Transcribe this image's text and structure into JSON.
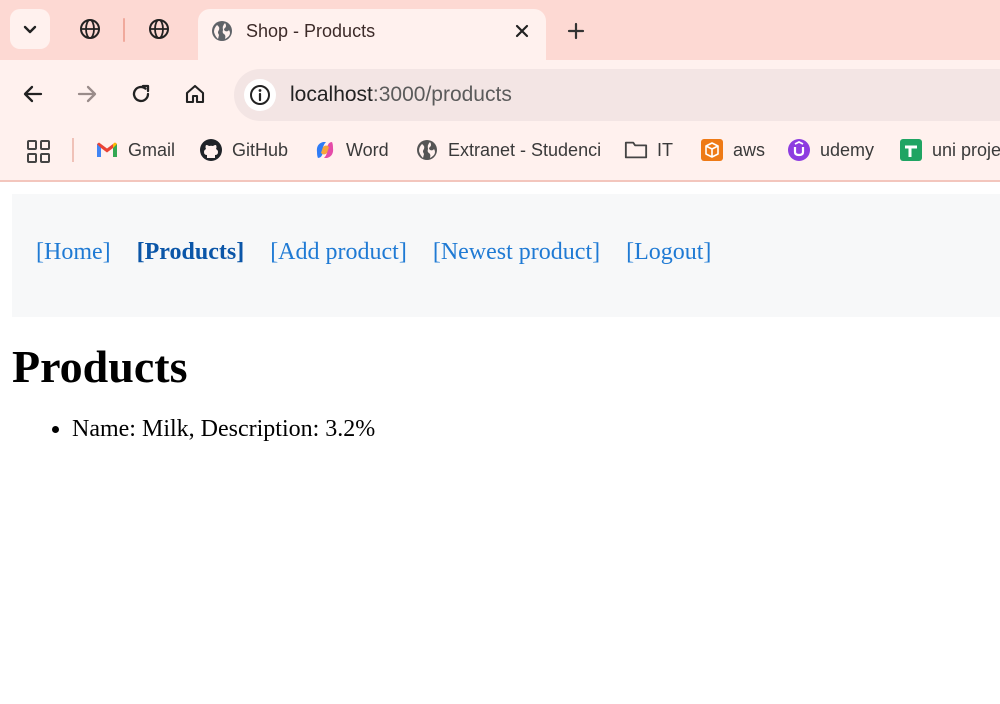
{
  "browser": {
    "tab": {
      "title": "Shop - Products"
    },
    "address": {
      "host": "localhost",
      "path": ":3000/products"
    },
    "bookmarks": [
      {
        "label": "Gmail",
        "icon": "gmail-icon"
      },
      {
        "label": "GitHub",
        "icon": "github-icon"
      },
      {
        "label": "Word",
        "icon": "copilot-icon"
      },
      {
        "label": "Extranet - Studenci",
        "icon": "globe-icon"
      },
      {
        "label": "IT",
        "icon": "folder-icon"
      },
      {
        "label": "aws",
        "icon": "aws-icon"
      },
      {
        "label": "udemy",
        "icon": "udemy-icon"
      },
      {
        "label": "uni proje",
        "icon": "sheets-icon"
      }
    ]
  },
  "nav": {
    "links": [
      {
        "label": "[Home]"
      },
      {
        "label": "[Products]",
        "active": true
      },
      {
        "label": "[Add product]"
      },
      {
        "label": "[Newest product]"
      },
      {
        "label": "[Logout]"
      }
    ]
  },
  "page": {
    "title": "Products",
    "products": [
      {
        "text": "Name: Milk, Description: 3.2%"
      }
    ]
  },
  "colors": {
    "tabstrip": "#fdd9d3",
    "toolbar": "#fff1ee",
    "link": "#1f7ad4",
    "active_link": "#0b56a8"
  }
}
